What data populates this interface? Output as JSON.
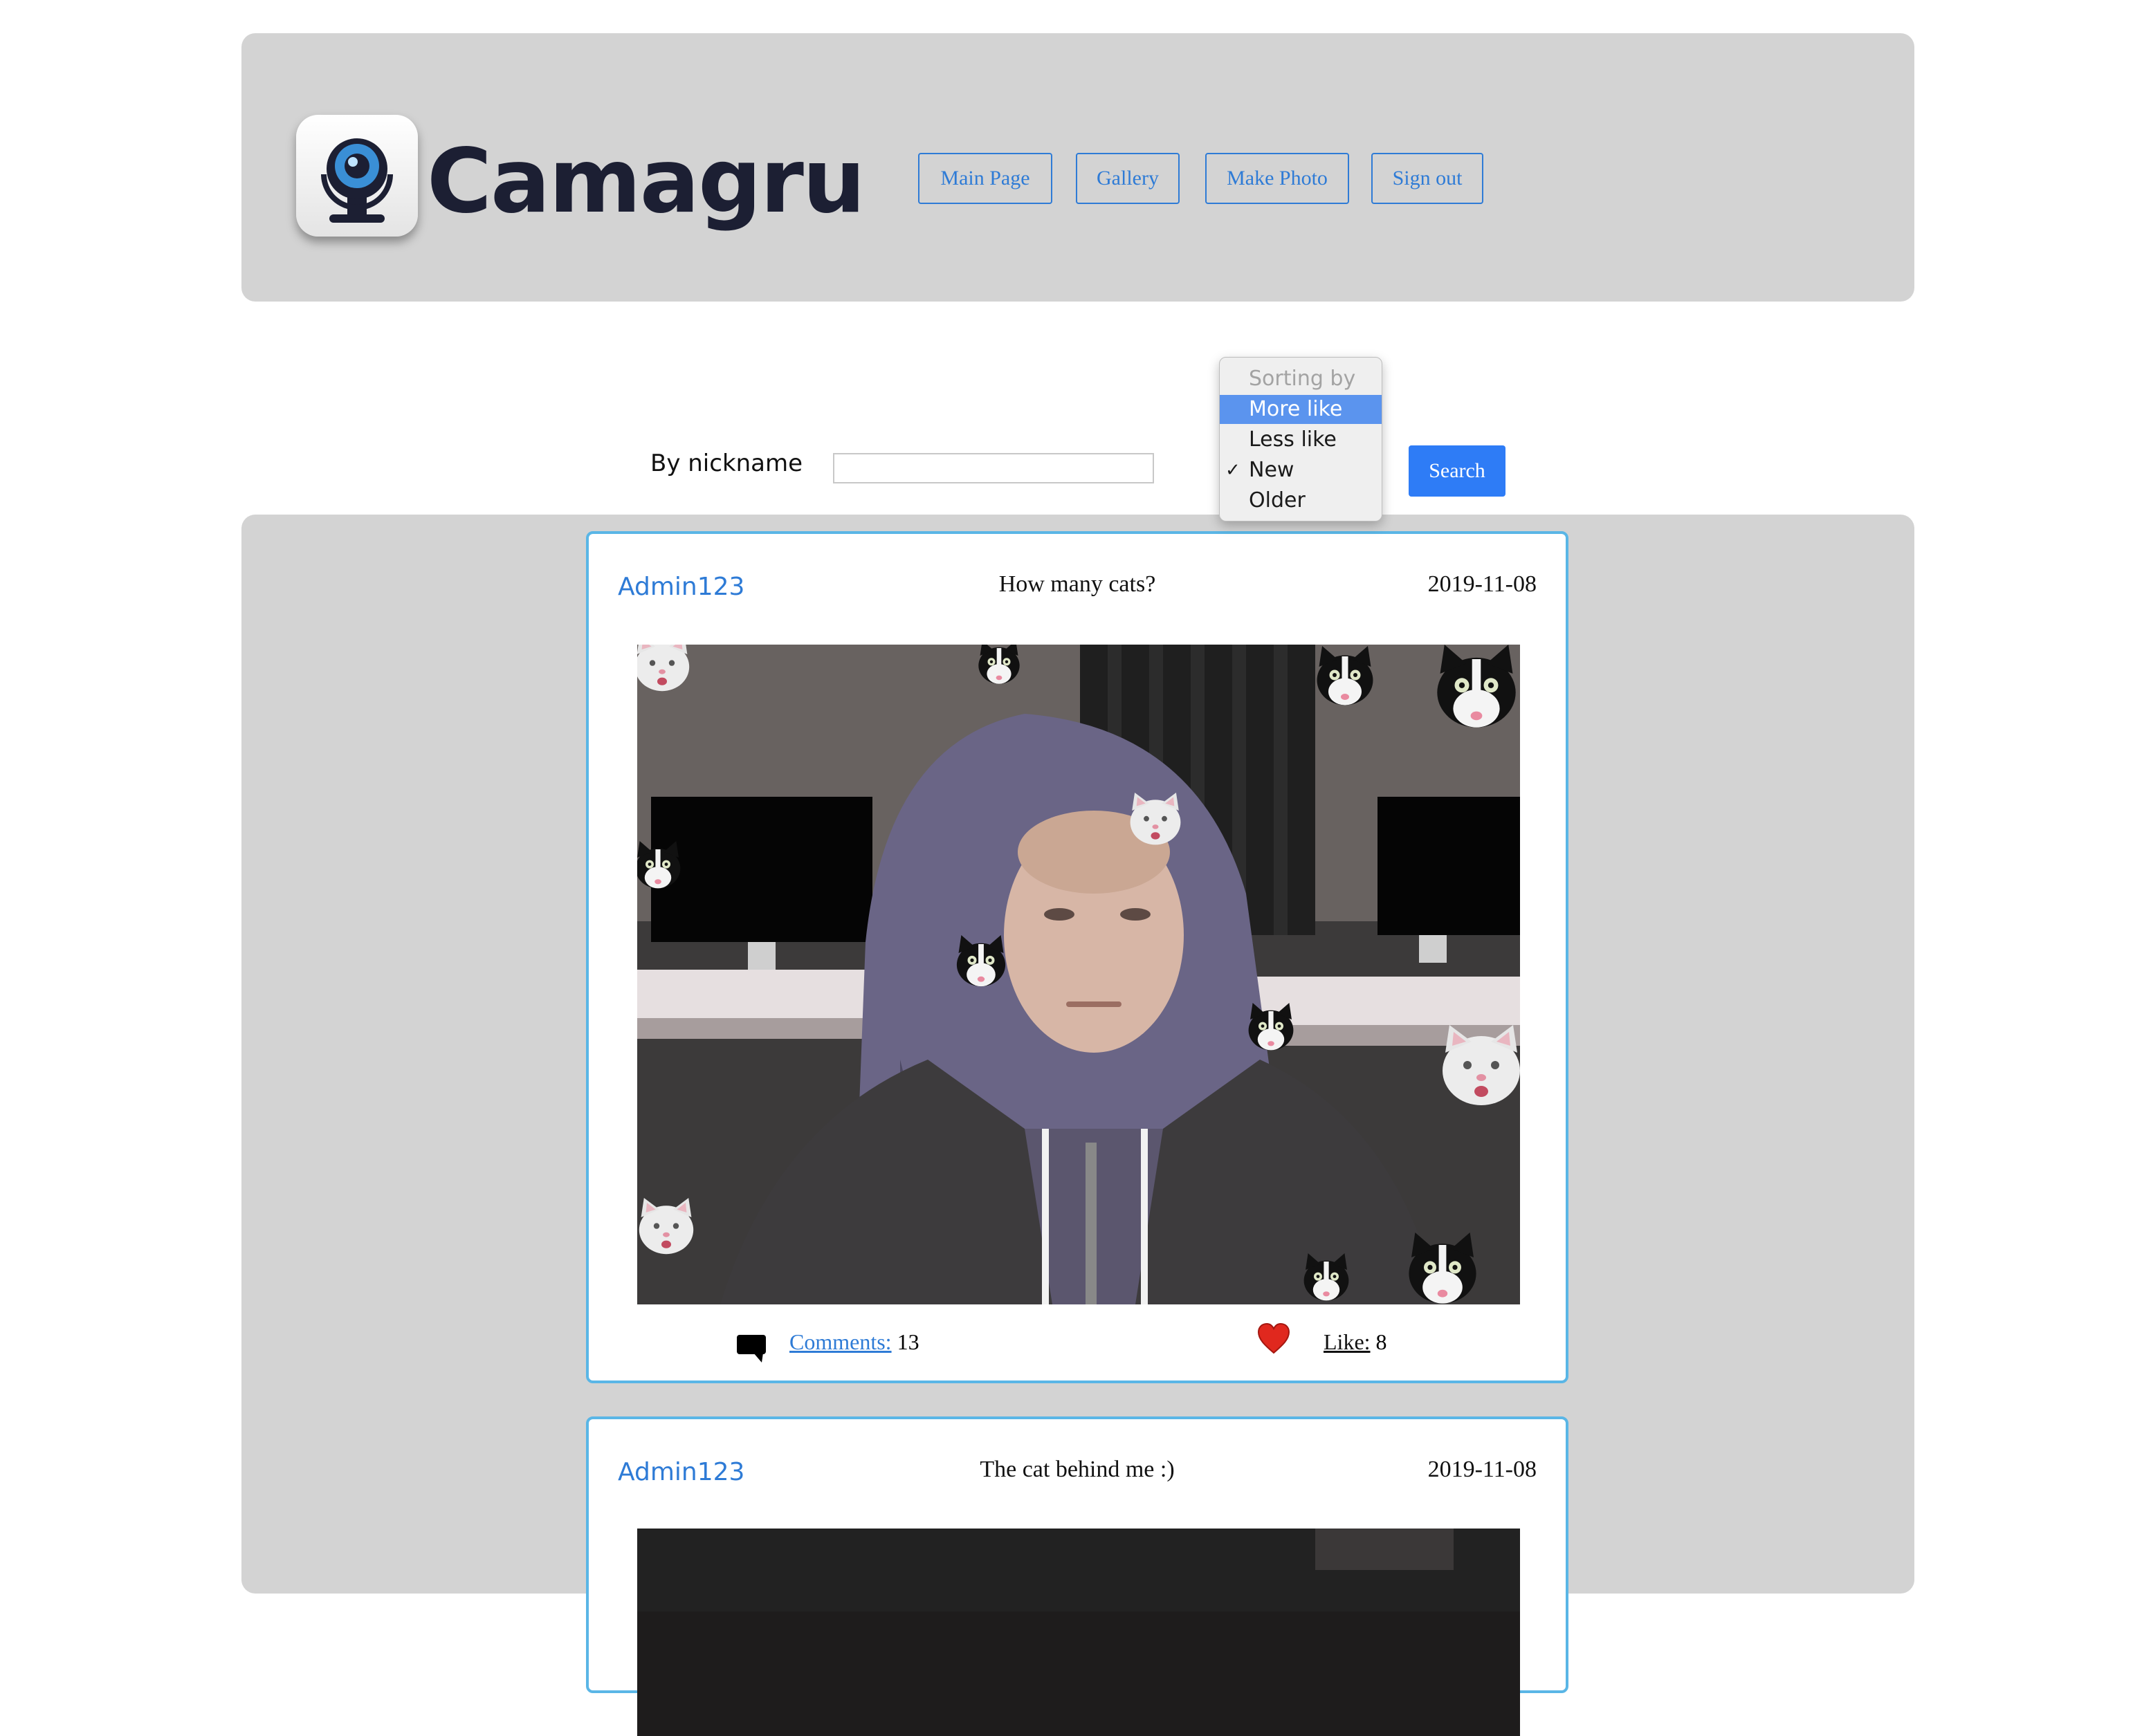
{
  "app": {
    "title": "Camagru"
  },
  "nav": {
    "main_page": "Main Page",
    "gallery": "Gallery",
    "make_photo": "Make Photo",
    "sign_out": "Sign out"
  },
  "filter": {
    "nickname_label": "By nickname",
    "nickname_value": "",
    "sort_options": [
      {
        "label": "Sorting by",
        "state": "disabled"
      },
      {
        "label": "More like",
        "state": "highlighted"
      },
      {
        "label": "Less like",
        "state": "normal"
      },
      {
        "label": "New",
        "state": "checked"
      },
      {
        "label": "Older",
        "state": "normal"
      }
    ],
    "search_label": "Search"
  },
  "posts": [
    {
      "author": "Admin123",
      "caption": "How many cats?",
      "date": "2019-11-08",
      "comments_label": "Comments:",
      "comments_count": "13",
      "like_label": "Like:",
      "like_count": "8"
    },
    {
      "author": "Admin123",
      "caption": "The cat behind me :)",
      "date": "2019-11-08"
    }
  ],
  "colors": {
    "accent": "#2e7bd6",
    "header_bg": "#d3d3d3",
    "card_border": "#5ab6e6",
    "search_bg": "#2e7cf6",
    "like_heart": "#e0281e"
  }
}
